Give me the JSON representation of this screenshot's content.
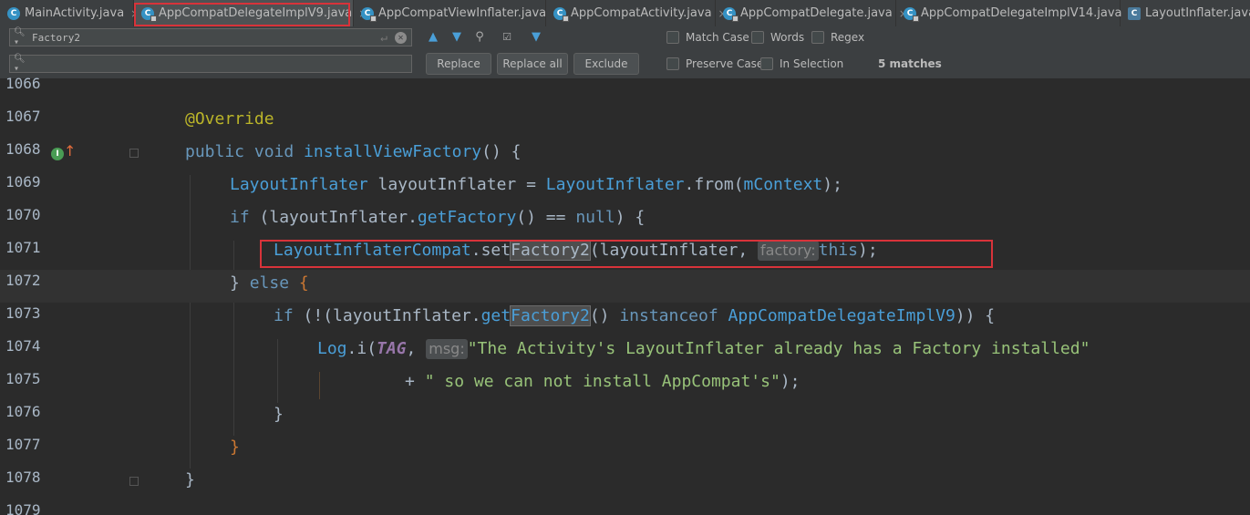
{
  "tabs": [
    {
      "label": "MainActivity.java",
      "icon": "class-icon"
    },
    {
      "label": "AppCompatDelegateImplV9.java",
      "icon": "class-icon"
    },
    {
      "label": "AppCompatViewInflater.java",
      "icon": "class-icon"
    },
    {
      "label": "AppCompatActivity.java",
      "icon": "class-icon"
    },
    {
      "label": "AppCompatDelegate.java",
      "icon": "class-icon"
    },
    {
      "label": "AppCompatDelegateImplV14.java",
      "icon": "class-icon"
    },
    {
      "label": "LayoutInflater.java",
      "icon": "class-icon"
    }
  ],
  "tab_close_glyph": "×",
  "search": {
    "find_value": "Factory2",
    "replace_value": "",
    "matches": "5 matches",
    "buttons": {
      "replace": "Replace",
      "replace_all": "Replace all",
      "exclude": "Exclude"
    },
    "options": {
      "match_case": "Match Case",
      "words": "Words",
      "regex": "Regex",
      "preserve_case": "Preserve Case",
      "in_selection": "In Selection"
    }
  },
  "editor": {
    "line_numbers": [
      "1066",
      "1067",
      "1068",
      "1069",
      "1070",
      "1071",
      "1072",
      "1073",
      "1074",
      "1075",
      "1076",
      "1077",
      "1078",
      "1079"
    ],
    "lines": {
      "l1067": "@Override",
      "l1068_kw": "public void ",
      "l1068_fn": "installViewFactory",
      "l1068_rest": "() {",
      "l1069_type": "LayoutInflater",
      "l1069_var": " layoutInflater = ",
      "l1069_type2": "LayoutInflater",
      "l1069_rest": ".from(",
      "l1069_field": "mContext",
      "l1069_end": ");",
      "l1070_kw": "if",
      "l1070_mid": " (layoutInflater.",
      "l1070_fn": "getFactory",
      "l1070_mid2": "() == ",
      "l1070_null": "null",
      "l1070_end": ") {",
      "l1071_type": "LayoutInflaterCompat",
      "l1071_mid": ".set",
      "l1071_match": "Factory2",
      "l1071_mid2": "(layoutInflater, ",
      "l1071_hint": "factory:",
      "l1071_this": "this",
      "l1071_end": ");",
      "l1072_a": "} ",
      "l1072_else": "else",
      "l1072_b": " {",
      "l1073_kw": "if",
      "l1073_mid": " (!(layoutInflater.",
      "l1073_fn": "get",
      "l1073_match": "Factory2",
      "l1073_mid2": "() ",
      "l1073_inst": "instanceof",
      "l1073_type": " AppCompatDelegateImplV9",
      "l1073_end": ")) {",
      "l1074_log": "Log",
      "l1074_mid": ".i(",
      "l1074_tag": "TAG",
      "l1074_comma": ", ",
      "l1074_hint": "msg:",
      "l1074_str": "\"The Activity's LayoutInflater already has a Factory installed\"",
      "l1075_plus": "+ ",
      "l1075_str": "\" so we can not install AppCompat's\"",
      "l1075_end": ");",
      "l1076": "}",
      "l1077": "}",
      "l1078": "}"
    }
  },
  "colors": {
    "keyword": "#6897bb",
    "string": "#6a8759",
    "annotation": "#bbb529",
    "highlight_box": "#d8333a"
  }
}
